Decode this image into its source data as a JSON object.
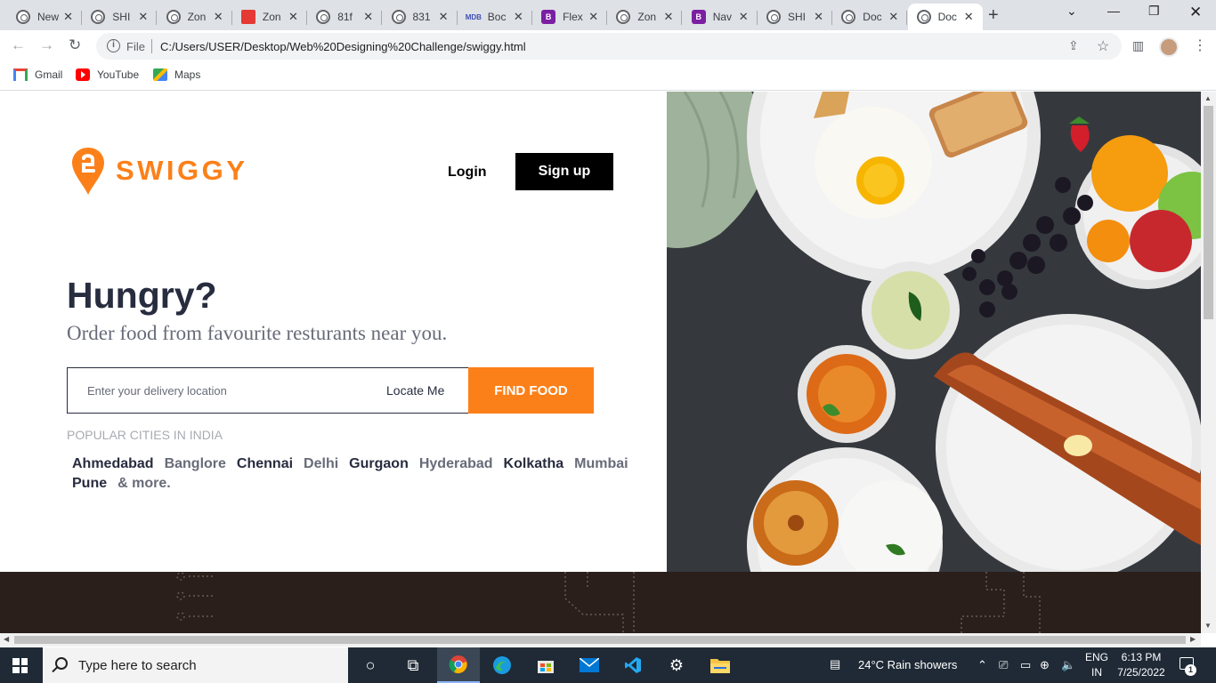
{
  "browser": {
    "tabs": [
      {
        "title": "New",
        "icon": "chrome-icon"
      },
      {
        "title": "SHI",
        "icon": "globe-icon"
      },
      {
        "title": "Zon",
        "icon": "globe-icon"
      },
      {
        "title": "Zon",
        "icon": "zomato-icon"
      },
      {
        "title": "81f",
        "icon": "globe-icon"
      },
      {
        "title": "831",
        "icon": "globe-icon"
      },
      {
        "title": "Boc",
        "icon": "mdb-icon"
      },
      {
        "title": "Flex",
        "icon": "bootstrap-icon"
      },
      {
        "title": "Zon",
        "icon": "globe-icon"
      },
      {
        "title": "Nav",
        "icon": "bootstrap-icon"
      },
      {
        "title": "SHI",
        "icon": "globe-icon"
      },
      {
        "title": "Doc",
        "icon": "globe-icon"
      },
      {
        "title": "Doc",
        "icon": "globe-icon",
        "active": true
      }
    ],
    "omnibox": {
      "scheme_label": "File",
      "url": "C:/Users/USER/Desktop/Web%20Designing%20Challenge/swiggy.html"
    },
    "bookmarks": [
      {
        "label": "Gmail",
        "icon": "gmail-icon"
      },
      {
        "label": "YouTube",
        "icon": "youtube-icon"
      },
      {
        "label": "Maps",
        "icon": "maps-icon"
      }
    ]
  },
  "page": {
    "brand": {
      "name": "SWIGGY",
      "color": "#fc8019"
    },
    "nav": {
      "login": "Login",
      "signup": "Sign up"
    },
    "hero": {
      "title": "Hungry?",
      "subtitle": "Order food from favourite resturants near you."
    },
    "search": {
      "placeholder": "Enter your delivery location",
      "locate_label": "Locate Me",
      "submit_label": "FIND FOOD"
    },
    "popular": {
      "label": "POPULAR CITIES IN INDIA",
      "cities": [
        {
          "name": "Ahmedabad",
          "tone": "dark"
        },
        {
          "name": "Banglore",
          "tone": "light"
        },
        {
          "name": "Chennai",
          "tone": "dark"
        },
        {
          "name": "Delhi",
          "tone": "light"
        },
        {
          "name": "Gurgaon",
          "tone": "dark"
        },
        {
          "name": "Hyderabad",
          "tone": "light"
        },
        {
          "name": "Kolkatha",
          "tone": "dark"
        },
        {
          "name": "Mumbai",
          "tone": "light"
        },
        {
          "name": "Pune",
          "tone": "dark"
        },
        {
          "name": "& more.",
          "tone": "light"
        }
      ]
    }
  },
  "taskbar": {
    "search_placeholder": "Type here to search",
    "weather": "24°C  Rain showers",
    "language": {
      "line1": "ENG",
      "line2": "IN"
    },
    "clock": {
      "time": "6:13 PM",
      "date": "7/25/2022"
    },
    "notification_count": "1"
  }
}
